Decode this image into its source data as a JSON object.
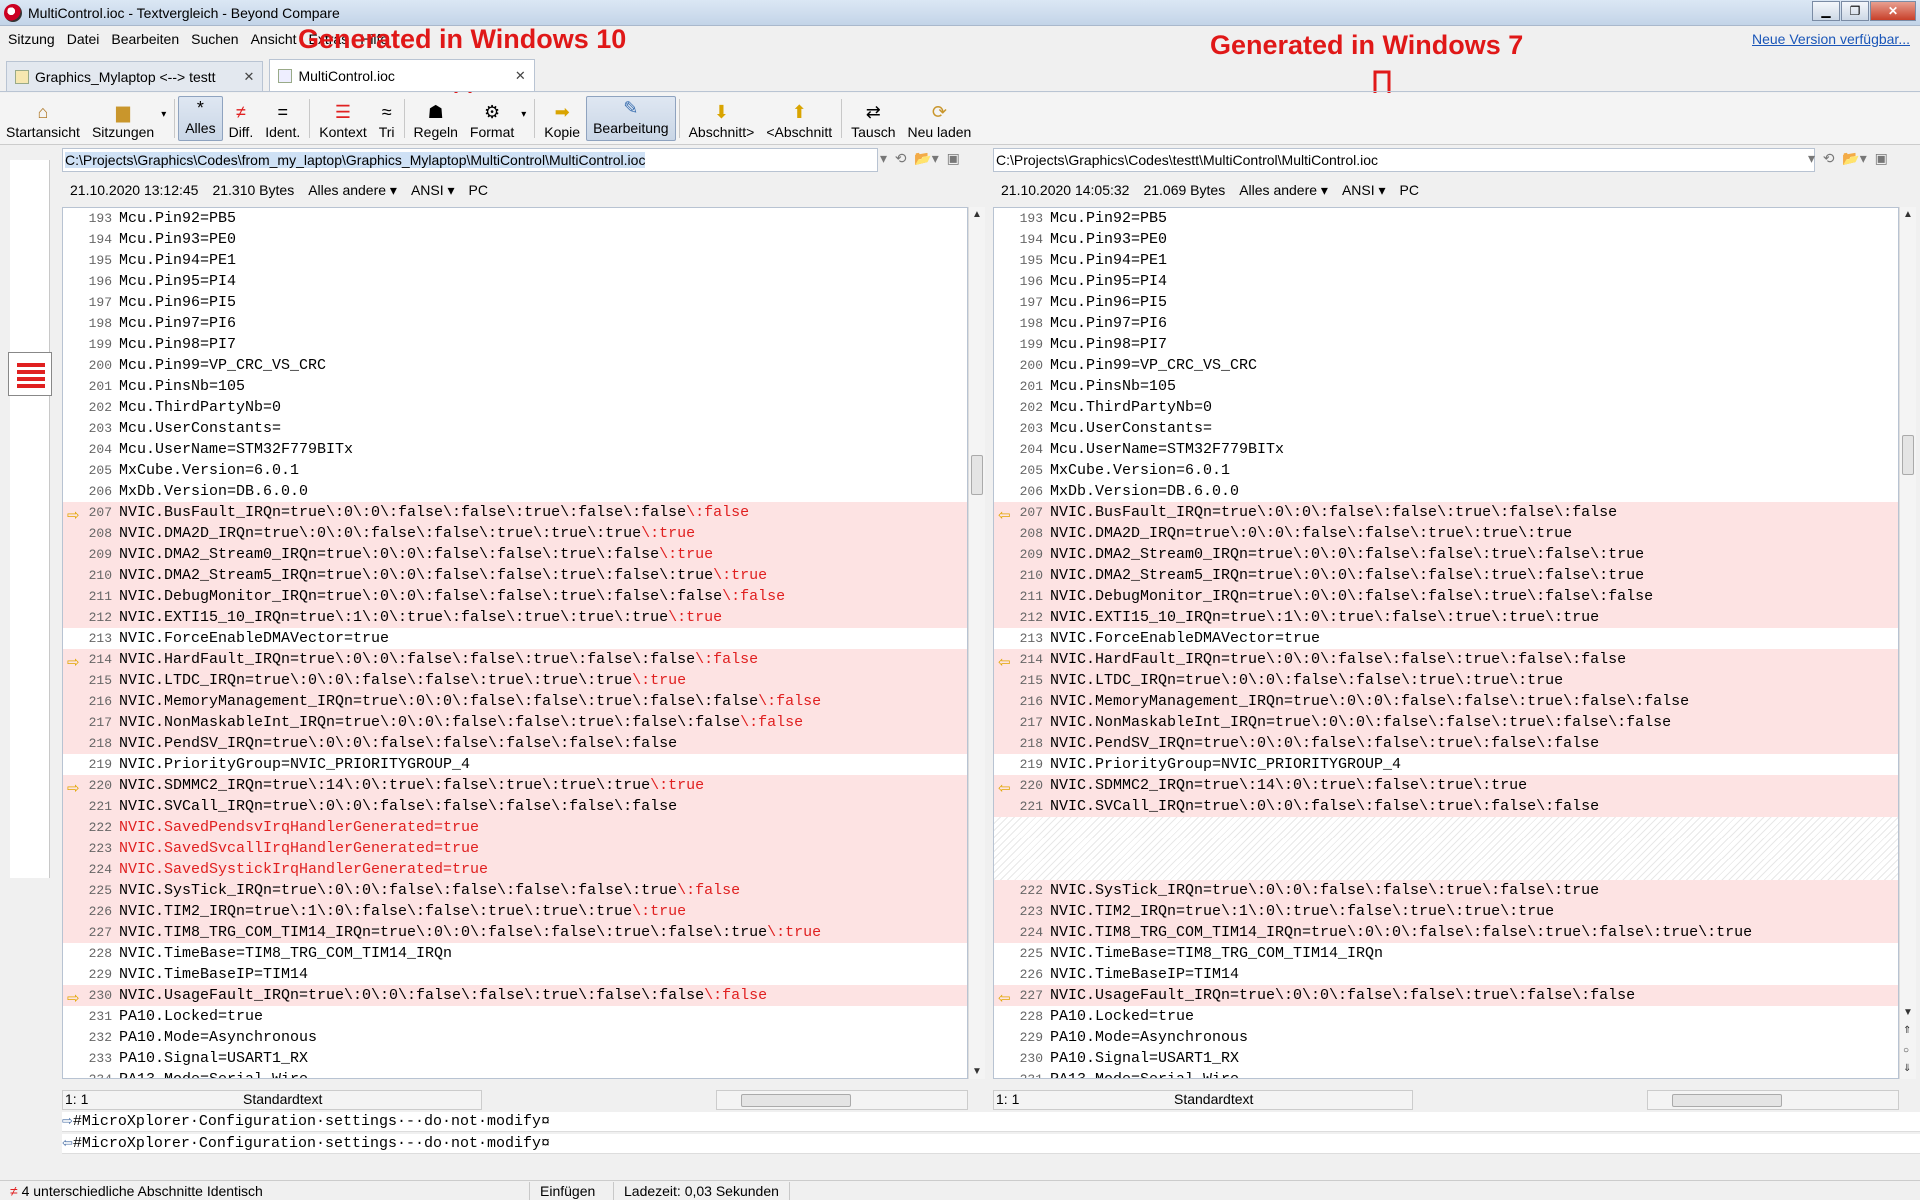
{
  "window": {
    "title": "MultiControl.ioc - Textvergleich - Beyond Compare"
  },
  "menu": {
    "items": [
      "Sitzung",
      "Datei",
      "Bearbeiten",
      "Suchen",
      "Ansicht",
      "Extras",
      "Hilfe"
    ],
    "new_version": "Neue Version verfügbar..."
  },
  "annotations": {
    "left": "Generated in Windows 10",
    "right": "Generated in Windows 7"
  },
  "tabs": [
    {
      "label": "Graphics_Mylaptop <--> testt"
    },
    {
      "label": "MultiControl.ioc"
    }
  ],
  "toolbar": {
    "home": "Startansicht",
    "sessions": "Sitzungen",
    "all": "Alles",
    "diffs": "Diff.",
    "same": "Ident.",
    "context": "Kontext",
    "minor": "Tri",
    "rules": "Regeln",
    "format": "Format",
    "copy": "Kopie",
    "edit": "Bearbeitung",
    "next_section": "Abschnitt>",
    "prev_section": "<Abschnitt",
    "swap": "Tausch",
    "reload": "Neu laden"
  },
  "left": {
    "path": "C:\\Projects\\Graphics\\Codes\\from_my_laptop\\Graphics_Mylaptop\\MultiControl\\MultiControl.ioc",
    "date": "21.10.2020 13:12:45",
    "size": "21.310 Bytes",
    "filter": "Alles andere ▾",
    "encoding": "ANSI ▾",
    "lineend": "PC",
    "position": "1: 1",
    "mode": "Standardtext"
  },
  "right": {
    "path": "C:\\Projects\\Graphics\\Codes\\testt\\MultiControl\\MultiControl.ioc",
    "date": "21.10.2020 14:05:32",
    "size": "21.069 Bytes",
    "filter": "Alles andere ▾",
    "encoding": "ANSI ▾",
    "lineend": "PC",
    "position": "1: 1",
    "mode": "Standardtext"
  },
  "left_lines": [
    {
      "n": "193",
      "t": "Mcu.Pin92=PB5"
    },
    {
      "n": "194",
      "t": "Mcu.Pin93=PE0"
    },
    {
      "n": "195",
      "t": "Mcu.Pin94=PE1"
    },
    {
      "n": "196",
      "t": "Mcu.Pin95=PI4"
    },
    {
      "n": "197",
      "t": "Mcu.Pin96=PI5"
    },
    {
      "n": "198",
      "t": "Mcu.Pin97=PI6"
    },
    {
      "n": "199",
      "t": "Mcu.Pin98=PI7"
    },
    {
      "n": "200",
      "t": "Mcu.Pin99=VP_CRC_VS_CRC"
    },
    {
      "n": "201",
      "t": "Mcu.PinsNb=105"
    },
    {
      "n": "202",
      "t": "Mcu.ThirdPartyNb=0"
    },
    {
      "n": "203",
      "t": "Mcu.UserConstants="
    },
    {
      "n": "204",
      "t": "Mcu.UserName=STM32F779BITx"
    },
    {
      "n": "205",
      "t": "MxCube.Version=6.0.1"
    },
    {
      "n": "206",
      "t": "MxDb.Version=DB.6.0.0"
    },
    {
      "n": "207",
      "t": "NVIC.BusFault_IRQn=true\\:0\\:0\\:false\\:false\\:true\\:false\\:false",
      "r": "\\:false",
      "d": true,
      "m": true
    },
    {
      "n": "208",
      "t": "NVIC.DMA2D_IRQn=true\\:0\\:0\\:false\\:false\\:true\\:true\\:true",
      "r": "\\:true",
      "d": true
    },
    {
      "n": "209",
      "t": "NVIC.DMA2_Stream0_IRQn=true\\:0\\:0\\:false\\:false\\:true\\:false",
      "r": "\\:true",
      "d": true
    },
    {
      "n": "210",
      "t": "NVIC.DMA2_Stream5_IRQn=true\\:0\\:0\\:false\\:false\\:true\\:false\\:true",
      "r": "\\:true",
      "d": true
    },
    {
      "n": "211",
      "t": "NVIC.DebugMonitor_IRQn=true\\:0\\:0\\:false\\:false\\:true\\:false\\:false",
      "r": "\\:false",
      "d": true
    },
    {
      "n": "212",
      "t": "NVIC.EXTI15_10_IRQn=true\\:1\\:0\\:true\\:false\\:true\\:true\\:true",
      "r": "\\:true",
      "d": true
    },
    {
      "n": "213",
      "t": "NVIC.ForceEnableDMAVector=true"
    },
    {
      "n": "214",
      "t": "NVIC.HardFault_IRQn=true\\:0\\:0\\:false\\:false\\:true\\:false\\:false",
      "r": "\\:false",
      "d": true,
      "m": true
    },
    {
      "n": "215",
      "t": "NVIC.LTDC_IRQn=true\\:0\\:0\\:false\\:false\\:true\\:true\\:true",
      "r": "\\:true",
      "d": true
    },
    {
      "n": "216",
      "t": "NVIC.MemoryManagement_IRQn=true\\:0\\:0\\:false\\:false\\:true\\:false\\:false",
      "r": "\\:false",
      "d": true
    },
    {
      "n": "217",
      "t": "NVIC.NonMaskableInt_IRQn=true\\:0\\:0\\:false\\:false\\:true\\:false\\:false",
      "r": "\\:false",
      "d": true
    },
    {
      "n": "218",
      "t": "NVIC.PendSV_IRQn=true\\:0\\:0\\:false\\:false\\:false\\:false\\:false",
      "d": true
    },
    {
      "n": "219",
      "t": "NVIC.PriorityGroup=NVIC_PRIORITYGROUP_4"
    },
    {
      "n": "220",
      "t": "NVIC.SDMMC2_IRQn=true\\:14\\:0\\:true\\:false\\:true\\:true\\:true",
      "r": "\\:true",
      "d": true,
      "m": true
    },
    {
      "n": "221",
      "t": "NVIC.SVCall_IRQn=true\\:0\\:0\\:false\\:false\\:false\\:false\\:false",
      "d": true
    },
    {
      "n": "222",
      "t": "",
      "r": "NVIC.SavedPendsvIrqHandlerGenerated=true",
      "d": true
    },
    {
      "n": "223",
      "t": "",
      "r": "NVIC.SavedSvcallIrqHandlerGenerated=true",
      "d": true
    },
    {
      "n": "224",
      "t": "",
      "r": "NVIC.SavedSystickIrqHandlerGenerated=true",
      "d": true
    },
    {
      "n": "225",
      "t": "NVIC.SysTick_IRQn=true\\:0\\:0\\:false\\:false\\:false\\:false\\:true",
      "r": "\\:false",
      "d": true
    },
    {
      "n": "226",
      "t": "NVIC.TIM2_IRQn=true\\:1\\:0\\:false\\:false\\:true\\:true\\:true",
      "r": "\\:true",
      "d": true
    },
    {
      "n": "227",
      "t": "NVIC.TIM8_TRG_COM_TIM14_IRQn=true\\:0\\:0\\:false\\:false\\:true\\:false\\:true",
      "r": "\\:true",
      "d": true
    },
    {
      "n": "228",
      "t": "NVIC.TimeBase=TIM8_TRG_COM_TIM14_IRQn"
    },
    {
      "n": "229",
      "t": "NVIC.TimeBaseIP=TIM14"
    },
    {
      "n": "230",
      "t": "NVIC.UsageFault_IRQn=true\\:0\\:0\\:false\\:false\\:true\\:false\\:false",
      "r": "\\:false",
      "d": true,
      "m": true
    },
    {
      "n": "231",
      "t": "PA10.Locked=true"
    },
    {
      "n": "232",
      "t": "PA10.Mode=Asynchronous"
    },
    {
      "n": "233",
      "t": "PA10.Signal=USART1_RX"
    },
    {
      "n": "234",
      "t": "PA13.Mode=Serial_Wire"
    }
  ],
  "right_lines": [
    {
      "n": "193",
      "t": "Mcu.Pin92=PB5"
    },
    {
      "n": "194",
      "t": "Mcu.Pin93=PE0"
    },
    {
      "n": "195",
      "t": "Mcu.Pin94=PE1"
    },
    {
      "n": "196",
      "t": "Mcu.Pin95=PI4"
    },
    {
      "n": "197",
      "t": "Mcu.Pin96=PI5"
    },
    {
      "n": "198",
      "t": "Mcu.Pin97=PI6"
    },
    {
      "n": "199",
      "t": "Mcu.Pin98=PI7"
    },
    {
      "n": "200",
      "t": "Mcu.Pin99=VP_CRC_VS_CRC"
    },
    {
      "n": "201",
      "t": "Mcu.PinsNb=105"
    },
    {
      "n": "202",
      "t": "Mcu.ThirdPartyNb=0"
    },
    {
      "n": "203",
      "t": "Mcu.UserConstants="
    },
    {
      "n": "204",
      "t": "Mcu.UserName=STM32F779BITx"
    },
    {
      "n": "205",
      "t": "MxCube.Version=6.0.1"
    },
    {
      "n": "206",
      "t": "MxDb.Version=DB.6.0.0"
    },
    {
      "n": "207",
      "t": "NVIC.BusFault_IRQn=true\\:0\\:0\\:false\\:false\\:true\\:false\\:false",
      "d": true,
      "m": true
    },
    {
      "n": "208",
      "t": "NVIC.DMA2D_IRQn=true\\:0\\:0\\:false\\:false\\:true\\:true\\:true",
      "d": true
    },
    {
      "n": "209",
      "t": "NVIC.DMA2_Stream0_IRQn=true\\:0\\:0\\:false\\:false\\:true\\:false\\:true",
      "d": true
    },
    {
      "n": "210",
      "t": "NVIC.DMA2_Stream5_IRQn=true\\:0\\:0\\:false\\:false\\:true\\:false\\:true",
      "d": true
    },
    {
      "n": "211",
      "t": "NVIC.DebugMonitor_IRQn=true\\:0\\:0\\:false\\:false\\:true\\:false\\:false",
      "d": true
    },
    {
      "n": "212",
      "t": "NVIC.EXTI15_10_IRQn=true\\:1\\:0\\:true\\:false\\:true\\:true\\:true",
      "d": true
    },
    {
      "n": "213",
      "t": "NVIC.ForceEnableDMAVector=true"
    },
    {
      "n": "214",
      "t": "NVIC.HardFault_IRQn=true\\:0\\:0\\:false\\:false\\:true\\:false\\:false",
      "d": true,
      "m": true
    },
    {
      "n": "215",
      "t": "NVIC.LTDC_IRQn=true\\:0\\:0\\:false\\:false\\:true\\:true\\:true",
      "d": true
    },
    {
      "n": "216",
      "t": "NVIC.MemoryManagement_IRQn=true\\:0\\:0\\:false\\:false\\:true\\:false\\:false",
      "d": true
    },
    {
      "n": "217",
      "t": "NVIC.NonMaskableInt_IRQn=true\\:0\\:0\\:false\\:false\\:true\\:false\\:false",
      "d": true
    },
    {
      "n": "218",
      "t": "NVIC.PendSV_IRQn=true\\:0\\:0\\:false\\:false\\:true\\:false\\:false",
      "d": true
    },
    {
      "n": "219",
      "t": "NVIC.PriorityGroup=NVIC_PRIORITYGROUP_4"
    },
    {
      "n": "220",
      "t": "NVIC.SDMMC2_IRQn=true\\:14\\:0\\:true\\:false\\:true\\:true",
      "d": true,
      "m": true
    },
    {
      "n": "221",
      "t": "NVIC.SVCall_IRQn=true\\:0\\:0\\:false\\:false\\:true\\:false\\:false",
      "d": true
    },
    {
      "n": "",
      "t": "",
      "b": true
    },
    {
      "n": "",
      "t": "",
      "b": true
    },
    {
      "n": "",
      "t": "",
      "b": true
    },
    {
      "n": "222",
      "t": "NVIC.SysTick_IRQn=true\\:0\\:0\\:false\\:false\\:true\\:false\\:true",
      "d": true
    },
    {
      "n": "223",
      "t": "NVIC.TIM2_IRQn=true\\:1\\:0\\:true\\:false\\:true\\:true\\:true",
      "d": true
    },
    {
      "n": "224",
      "t": "NVIC.TIM8_TRG_COM_TIM14_IRQn=true\\:0\\:0\\:false\\:false\\:true\\:false\\:true\\:true",
      "d": true
    },
    {
      "n": "225",
      "t": "NVIC.TimeBase=TIM8_TRG_COM_TIM14_IRQn"
    },
    {
      "n": "226",
      "t": "NVIC.TimeBaseIP=TIM14"
    },
    {
      "n": "227",
      "t": "NVIC.UsageFault_IRQn=true\\:0\\:0\\:false\\:false\\:true\\:false\\:false",
      "d": true,
      "m": true
    },
    {
      "n": "228",
      "t": "PA10.Locked=true"
    },
    {
      "n": "229",
      "t": "PA10.Mode=Asynchronous"
    },
    {
      "n": "230",
      "t": "PA10.Signal=USART1_RX"
    },
    {
      "n": "231",
      "t": "PA13.Mode=Serial_Wire"
    }
  ],
  "bottom": {
    "line1": "#MicroXplorer·Configuration·settings·-·do·not·modify¤",
    "line2": "#MicroXplorer·Configuration·settings·-·do·not·modify¤"
  },
  "status": {
    "sections": "4 unterschiedliche Abschnitte",
    "identical": "Identisch",
    "insert": "Einfügen",
    "load": "Ladezeit: 0,03 Sekunden"
  }
}
